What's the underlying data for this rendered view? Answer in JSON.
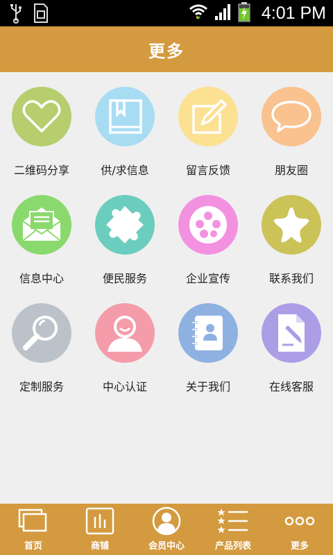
{
  "status_bar": {
    "time": "4:01 PM",
    "icons": [
      "usb-icon",
      "sim-icon",
      "wifi-icon",
      "signal-icon",
      "battery-icon"
    ]
  },
  "header": {
    "title": "更多"
  },
  "grid": {
    "items": [
      {
        "label": "二维码分享",
        "icon": "heart-icon",
        "color": "#b6ce6e"
      },
      {
        "label": "供/求信息",
        "icon": "book-icon",
        "color": "#a8dcf3"
      },
      {
        "label": "留言反馈",
        "icon": "edit-note-icon",
        "color": "#fbe191"
      },
      {
        "label": "朋友圈",
        "icon": "chat-bubble-icon",
        "color": "#f9c28f"
      },
      {
        "label": "信息中心",
        "icon": "mail-icon",
        "color": "#8ad96d"
      },
      {
        "label": "便民服务",
        "icon": "puzzle-icon",
        "color": "#6bcdbd"
      },
      {
        "label": "企业宣传",
        "icon": "film-reel-icon",
        "color": "#f391e1"
      },
      {
        "label": "联系我们",
        "icon": "star-icon",
        "color": "#cbc357"
      },
      {
        "label": "定制服务",
        "icon": "magnifier-icon",
        "color": "#bcc2c9"
      },
      {
        "label": "中心认证",
        "icon": "user-icon",
        "color": "#f59cab"
      },
      {
        "label": "关于我们",
        "icon": "contacts-book-icon",
        "color": "#8fb1e1"
      },
      {
        "label": "在线客服",
        "icon": "document-edit-icon",
        "color": "#ac9de7"
      }
    ]
  },
  "bottom_nav": {
    "items": [
      {
        "label": "首页",
        "icon": "home-windows-icon"
      },
      {
        "label": "商铺",
        "icon": "shop-icon"
      },
      {
        "label": "会员中心",
        "icon": "member-icon"
      },
      {
        "label": "产品列表",
        "icon": "list-icon"
      },
      {
        "label": "更多",
        "icon": "more-dots-icon"
      }
    ]
  }
}
